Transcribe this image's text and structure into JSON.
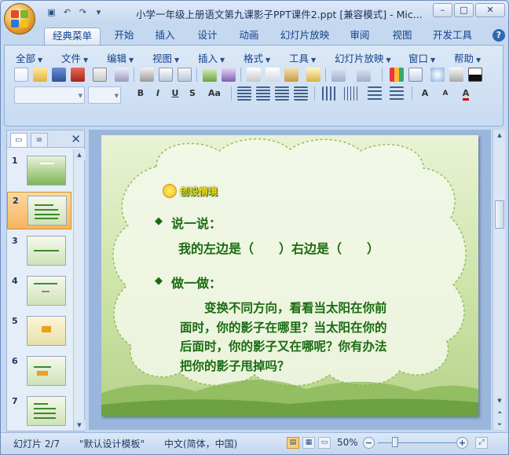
{
  "window": {
    "title": "小学一年级上册语文第九课影子PPT课件2.ppt [兼容模式] - Mic...",
    "controls": {
      "minimize": "–",
      "maximize": "□",
      "close": "✕"
    }
  },
  "quick_access": {
    "save": "💾",
    "undo": "↶",
    "redo": "↷",
    "customize": "▾"
  },
  "ribbon_tabs": [
    {
      "label": "经典菜单",
      "active": true
    },
    {
      "label": "开始"
    },
    {
      "label": "插入"
    },
    {
      "label": "设计"
    },
    {
      "label": "动画"
    },
    {
      "label": "幻灯片放映"
    },
    {
      "label": "审阅"
    },
    {
      "label": "视图"
    },
    {
      "label": "开发工具"
    }
  ],
  "help_label": "?",
  "menus": [
    {
      "label": "全部"
    },
    {
      "label": "文件"
    },
    {
      "label": "编辑"
    },
    {
      "label": "视图"
    },
    {
      "label": "插入"
    },
    {
      "label": "格式"
    },
    {
      "label": "工具"
    },
    {
      "label": "幻灯片放映"
    },
    {
      "label": "窗口"
    },
    {
      "label": "帮助"
    }
  ],
  "format_buttons": {
    "bold": "B",
    "italic": "I",
    "underline": "U",
    "strike": "S",
    "case": "Aa"
  },
  "left_pane": {
    "tab_slides": "▭",
    "tab_outline": "≡",
    "close": "✕",
    "slides": [
      {
        "num": "1",
        "selected": false
      },
      {
        "num": "2",
        "selected": true
      },
      {
        "num": "3",
        "selected": false
      },
      {
        "num": "4",
        "selected": false
      },
      {
        "num": "5",
        "selected": false
      },
      {
        "num": "6",
        "selected": false
      },
      {
        "num": "7",
        "selected": false
      }
    ]
  },
  "slide": {
    "badge": "创设情境",
    "bullet_mark": "◆",
    "heading1": "说一说：",
    "line1": "我的左边是（　　）右边是（　　）",
    "heading2": "做一做：",
    "paragraph": "　　变换不同方向，看看当太阳在你前\n面时，你的影子在哪里？当太阳在你的\n后面时，你的影子又在哪呢？你有办法\n把你的影子甩掉吗？"
  },
  "status_bar": {
    "slide_info": "幻灯片 2/7",
    "template": "\"默认设计模板\"",
    "language": "中文(简体，中国)",
    "zoom": "50%",
    "zoom_out": "−",
    "zoom_in": "+"
  },
  "colors": {
    "slide_text": "#1a6b12",
    "selection": "#f6b45f",
    "ribbon": "#c9dbf2"
  }
}
